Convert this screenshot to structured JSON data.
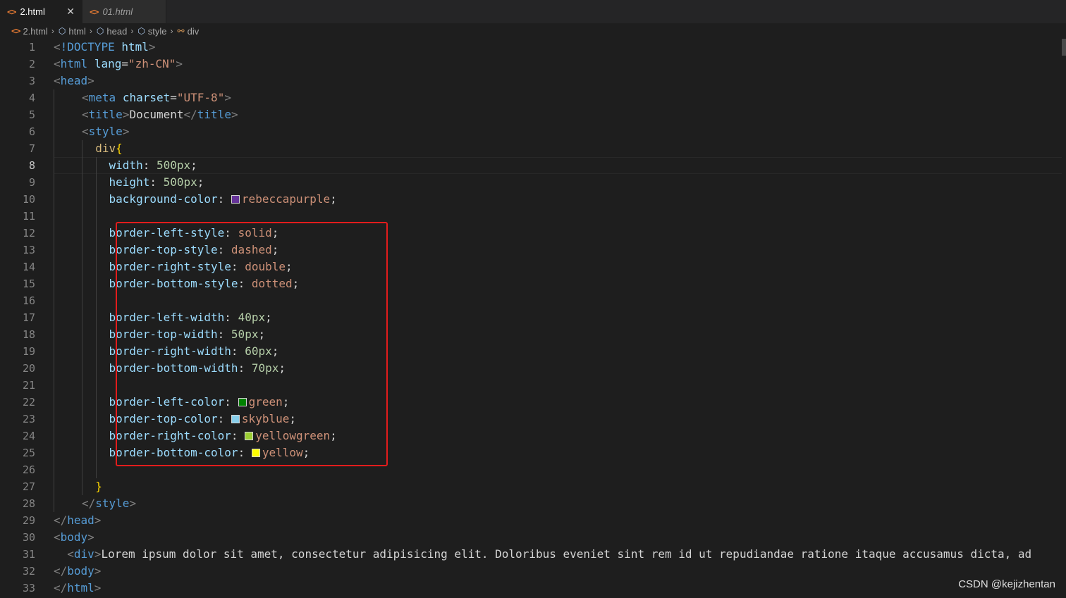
{
  "tabs": [
    {
      "label": "2.html",
      "active": true
    },
    {
      "label": "01.html",
      "active": false
    }
  ],
  "tab_icon_glyph": "<>",
  "close_glyph": "✕",
  "breadcrumb": [
    {
      "label": "2.html",
      "icon": "html-file-icon"
    },
    {
      "label": "html",
      "icon": "cube-icon"
    },
    {
      "label": "head",
      "icon": "cube-icon"
    },
    {
      "label": "style",
      "icon": "cube-icon"
    },
    {
      "label": "div",
      "icon": "css-selector-icon"
    }
  ],
  "current_line": 8,
  "lines": [
    {
      "n": 1,
      "i": 0,
      "t": [
        [
          "punc",
          "<"
        ],
        [
          "tag",
          "!DOCTYPE"
        ],
        [
          "text",
          " "
        ],
        [
          "attr",
          "html"
        ],
        [
          "punc",
          ">"
        ]
      ]
    },
    {
      "n": 2,
      "i": 0,
      "t": [
        [
          "punc",
          "<"
        ],
        [
          "tag",
          "html"
        ],
        [
          "text",
          " "
        ],
        [
          "attr",
          "lang"
        ],
        [
          "text",
          "="
        ],
        [
          "str",
          "\"zh-CN\""
        ],
        [
          "punc",
          ">"
        ]
      ]
    },
    {
      "n": 3,
      "i": 0,
      "t": [
        [
          "punc",
          "<"
        ],
        [
          "tag",
          "head"
        ],
        [
          "punc",
          ">"
        ]
      ]
    },
    {
      "n": 4,
      "i": 1,
      "t": [
        [
          "punc",
          "<"
        ],
        [
          "tag",
          "meta"
        ],
        [
          "text",
          " "
        ],
        [
          "attr",
          "charset"
        ],
        [
          "text",
          "="
        ],
        [
          "str",
          "\"UTF-8\""
        ],
        [
          "punc",
          ">"
        ]
      ]
    },
    {
      "n": 5,
      "i": 1,
      "t": [
        [
          "punc",
          "<"
        ],
        [
          "tag",
          "title"
        ],
        [
          "punc",
          ">"
        ],
        [
          "text",
          "Document"
        ],
        [
          "punc",
          "</"
        ],
        [
          "tag",
          "title"
        ],
        [
          "punc",
          ">"
        ]
      ]
    },
    {
      "n": 6,
      "i": 1,
      "t": [
        [
          "punc",
          "<"
        ],
        [
          "tag",
          "style"
        ],
        [
          "punc",
          ">"
        ]
      ]
    },
    {
      "n": 7,
      "i": 1,
      "s": "  ",
      "t": [
        [
          "sel",
          "div"
        ],
        [
          "brace",
          "{"
        ]
      ]
    },
    {
      "n": 8,
      "i": 1,
      "s": "    ",
      "t": [
        [
          "prop",
          "width"
        ],
        [
          "text",
          ": "
        ],
        [
          "num",
          "500px"
        ],
        [
          "text",
          ";"
        ]
      ]
    },
    {
      "n": 9,
      "i": 1,
      "s": "    ",
      "t": [
        [
          "prop",
          "height"
        ],
        [
          "text",
          ": "
        ],
        [
          "num",
          "500px"
        ],
        [
          "text",
          ";"
        ]
      ]
    },
    {
      "n": 10,
      "i": 1,
      "s": "    ",
      "t": [
        [
          "prop",
          "background-color"
        ],
        [
          "text",
          ": "
        ],
        [
          "swatch",
          "#663399"
        ],
        [
          "val",
          "rebeccapurple"
        ],
        [
          "text",
          ";"
        ]
      ]
    },
    {
      "n": 11,
      "i": 1,
      "s": "",
      "t": []
    },
    {
      "n": 12,
      "i": 1,
      "s": "    ",
      "t": [
        [
          "prop",
          "border-left-style"
        ],
        [
          "text",
          ": "
        ],
        [
          "val",
          "solid"
        ],
        [
          "text",
          ";"
        ]
      ]
    },
    {
      "n": 13,
      "i": 1,
      "s": "    ",
      "t": [
        [
          "prop",
          "border-top-style"
        ],
        [
          "text",
          ": "
        ],
        [
          "val",
          "dashed"
        ],
        [
          "text",
          ";"
        ]
      ]
    },
    {
      "n": 14,
      "i": 1,
      "s": "    ",
      "t": [
        [
          "prop",
          "border-right-style"
        ],
        [
          "text",
          ": "
        ],
        [
          "val",
          "double"
        ],
        [
          "text",
          ";"
        ]
      ]
    },
    {
      "n": 15,
      "i": 1,
      "s": "    ",
      "t": [
        [
          "prop",
          "border-bottom-style"
        ],
        [
          "text",
          ": "
        ],
        [
          "val",
          "dotted"
        ],
        [
          "text",
          ";"
        ]
      ]
    },
    {
      "n": 16,
      "i": 1,
      "s": "",
      "t": []
    },
    {
      "n": 17,
      "i": 1,
      "s": "    ",
      "t": [
        [
          "prop",
          "border-left-width"
        ],
        [
          "text",
          ": "
        ],
        [
          "num",
          "40px"
        ],
        [
          "text",
          ";"
        ]
      ]
    },
    {
      "n": 18,
      "i": 1,
      "s": "    ",
      "t": [
        [
          "prop",
          "border-top-width"
        ],
        [
          "text",
          ": "
        ],
        [
          "num",
          "50px"
        ],
        [
          "text",
          ";"
        ]
      ]
    },
    {
      "n": 19,
      "i": 1,
      "s": "    ",
      "t": [
        [
          "prop",
          "border-right-width"
        ],
        [
          "text",
          ": "
        ],
        [
          "num",
          "60px"
        ],
        [
          "text",
          ";"
        ]
      ]
    },
    {
      "n": 20,
      "i": 1,
      "s": "    ",
      "t": [
        [
          "prop",
          "border-bottom-width"
        ],
        [
          "text",
          ": "
        ],
        [
          "num",
          "70px"
        ],
        [
          "text",
          ";"
        ]
      ]
    },
    {
      "n": 21,
      "i": 1,
      "s": "",
      "t": []
    },
    {
      "n": 22,
      "i": 1,
      "s": "    ",
      "t": [
        [
          "prop",
          "border-left-color"
        ],
        [
          "text",
          ": "
        ],
        [
          "swatch",
          "#008000"
        ],
        [
          "val",
          "green"
        ],
        [
          "text",
          ";"
        ]
      ]
    },
    {
      "n": 23,
      "i": 1,
      "s": "    ",
      "t": [
        [
          "prop",
          "border-top-color"
        ],
        [
          "text",
          ": "
        ],
        [
          "swatch",
          "#87ceeb"
        ],
        [
          "val",
          "skyblue"
        ],
        [
          "text",
          ";"
        ]
      ]
    },
    {
      "n": 24,
      "i": 1,
      "s": "    ",
      "t": [
        [
          "prop",
          "border-right-color"
        ],
        [
          "text",
          ": "
        ],
        [
          "swatch",
          "#9acd32"
        ],
        [
          "val",
          "yellowgreen"
        ],
        [
          "text",
          ";"
        ]
      ]
    },
    {
      "n": 25,
      "i": 1,
      "s": "    ",
      "t": [
        [
          "prop",
          "border-bottom-color"
        ],
        [
          "text",
          ": "
        ],
        [
          "swatch",
          "#ffff00"
        ],
        [
          "val",
          "yellow"
        ],
        [
          "text",
          ";"
        ]
      ]
    },
    {
      "n": 26,
      "i": 1,
      "s": "",
      "t": []
    },
    {
      "n": 27,
      "i": 1,
      "s": "  ",
      "t": [
        [
          "brace",
          "}"
        ]
      ]
    },
    {
      "n": 28,
      "i": 1,
      "t": [
        [
          "punc",
          "</"
        ],
        [
          "tag",
          "style"
        ],
        [
          "punc",
          ">"
        ]
      ]
    },
    {
      "n": 29,
      "i": 0,
      "t": [
        [
          "punc",
          "</"
        ],
        [
          "tag",
          "head"
        ],
        [
          "punc",
          ">"
        ]
      ]
    },
    {
      "n": 30,
      "i": 0,
      "t": [
        [
          "punc",
          "<"
        ],
        [
          "tag",
          "body"
        ],
        [
          "punc",
          ">"
        ]
      ]
    },
    {
      "n": 31,
      "i": 0,
      "s": "  ",
      "t": [
        [
          "punc",
          "<"
        ],
        [
          "tag",
          "div"
        ],
        [
          "punc",
          ">"
        ],
        [
          "text",
          "Lorem ipsum dolor sit amet, consectetur adipisicing elit. Doloribus eveniet sint rem id ut repudiandae ratione itaque accusamus dicta, ad"
        ]
      ]
    },
    {
      "n": 32,
      "i": 0,
      "t": [
        [
          "punc",
          "</"
        ],
        [
          "tag",
          "body"
        ],
        [
          "punc",
          ">"
        ]
      ]
    },
    {
      "n": 33,
      "i": 0,
      "t": [
        [
          "punc",
          "</"
        ],
        [
          "tag",
          "html"
        ],
        [
          "punc",
          ">"
        ]
      ]
    }
  ],
  "watermark": "CSDN @kejizhentan",
  "colors": {
    "accent_box": "#e31c1c",
    "background": "#1e1e1e"
  }
}
